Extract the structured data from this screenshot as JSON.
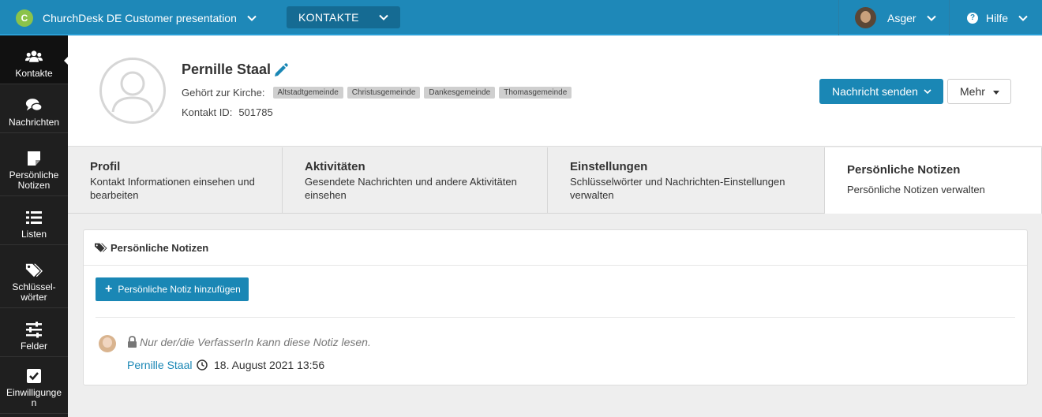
{
  "topbar": {
    "org_initial": "C",
    "org_name": "ChurchDesk DE Customer presentation",
    "module": "KONTAKTE",
    "user_name": "Asger",
    "help_label": "Hilfe"
  },
  "sidebar": {
    "items": [
      {
        "label": "Kontakte",
        "icon": "users-icon",
        "active": true
      },
      {
        "label": "Nachrichten",
        "icon": "chat-icon"
      },
      {
        "label": "Persönliche Notizen",
        "icon": "sticky-note-icon"
      },
      {
        "label": "Listen",
        "icon": "list-icon"
      },
      {
        "label": "Schlüssel-wörter",
        "icon": "tags-icon"
      },
      {
        "label": "Felder",
        "icon": "sliders-icon"
      },
      {
        "label": "Einwilligungen",
        "icon": "checkbox-icon"
      }
    ]
  },
  "contact": {
    "name": "Pernille Staal",
    "church_label": "Gehört zur Kirche:",
    "churches": [
      "Altstadtgemeinde",
      "Christusgemeinde",
      "Dankesgemeinde",
      "Thomasgemeinde"
    ],
    "id_label": "Kontakt ID:",
    "id_value": "501785"
  },
  "actions": {
    "send_label": "Nachricht senden",
    "more_label": "Mehr"
  },
  "tabs": [
    {
      "title": "Profil",
      "desc": "Kontakt Informationen einsehen und bearbeiten"
    },
    {
      "title": "Aktivitäten",
      "desc": "Gesendete Nachrichten und andere Aktivitäten einsehen"
    },
    {
      "title": "Einstellungen",
      "desc": "Schlüsselwörter und Nachrichten-Einstellungen verwalten"
    },
    {
      "title": "Persönliche Notizen",
      "desc": "Persönliche Notizen verwalten",
      "active": true
    }
  ],
  "panel": {
    "title": "Persönliche Notizen",
    "add_label": "Persönliche Notiz hinzufügen",
    "note": {
      "privacy_text": "Nur der/die VerfasserIn kann diese Notiz lesen.",
      "author": "Pernille Staal",
      "date": "18. August 2021 13:56"
    }
  },
  "colors": {
    "topbar": "#1e88b8",
    "sidebar": "#1f1f1f",
    "accent": "#1a87b5"
  }
}
